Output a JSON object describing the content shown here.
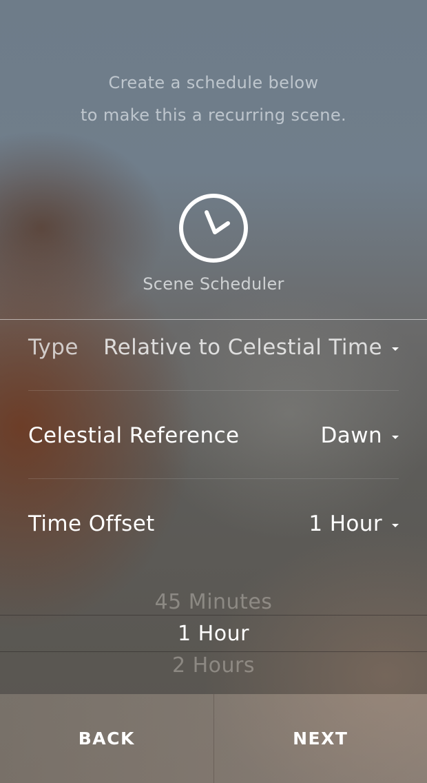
{
  "intro": {
    "line1": "Create a schedule below",
    "line2": "to make this a recurring scene."
  },
  "scheduler": {
    "icon": "clock-icon",
    "title": "Scene Scheduler"
  },
  "settings": [
    {
      "label": "Type",
      "value": "Relative to Celestial Time"
    },
    {
      "label": "Celestial Reference",
      "value": "Dawn"
    },
    {
      "label": "Time Offset",
      "value": "1 Hour"
    }
  ],
  "picker": {
    "options": [
      "45 Minutes",
      "1 Hour",
      "2 Hours"
    ],
    "selected": "1 Hour"
  },
  "navigation": {
    "back_label": "BACK",
    "next_label": "NEXT"
  }
}
